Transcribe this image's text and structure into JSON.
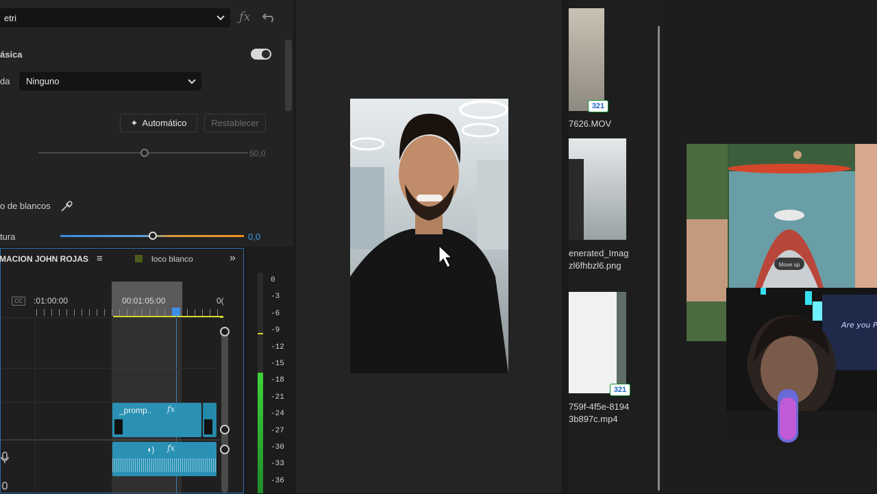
{
  "lumetri": {
    "preset_dropdown": "etri",
    "section_title": "ásica",
    "lut_label": "da",
    "lut_value": "Ninguno",
    "auto_button": "Automático",
    "reset_button": "Restablecer",
    "intensity_value": "50,0",
    "intensity_level_pct": 50,
    "white_balance_label": "o de blancos",
    "temperature_label": "tura",
    "temperature_value": "0,0"
  },
  "timeline": {
    "sequence_name": "MACION JOHN ROJAS",
    "menu_glyph": "≡",
    "second_tab": "loco blanco",
    "overflow_glyph": "»",
    "cc_label": "CC",
    "tc_left": ":01:00:00",
    "tc_mid": "00:01:05:00",
    "tc_right": "0(",
    "clip_video_label": "_promp..",
    "fx_label": "fx"
  },
  "meter": {
    "scale": [
      "0",
      "-3",
      "-6",
      "-9",
      "-12",
      "-15",
      "-18",
      "-21",
      "-24",
      "-27",
      "-30",
      "-33",
      "-36"
    ]
  },
  "bin": {
    "items": [
      {
        "name": "7626.MOV"
      },
      {
        "name": "enerated_Imag\nzl6fhbzl6.png"
      },
      {
        "name": "759f-4f5e-8194\n3b897c.mp4"
      }
    ],
    "badge": "321"
  },
  "overlay": {
    "kayak_button": "Move up",
    "hoodie_text": "Are you Player?"
  },
  "colors": {
    "accent_blue": "#2f6fb0",
    "clip_teal": "#2a91b4",
    "meter_green": "#2fbf3a",
    "timeline_yellow": "#d9d92a"
  }
}
